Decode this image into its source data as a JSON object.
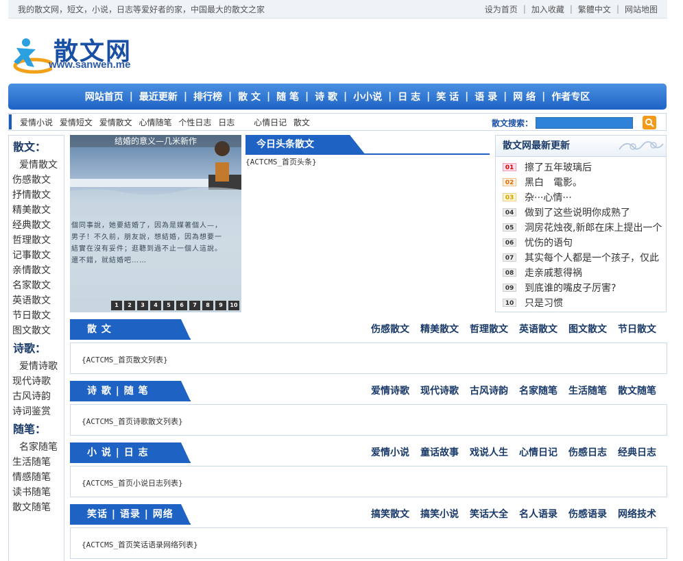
{
  "topbar": {
    "tagline": "我的散文网，短文，小说，日志等爱好者的家，中国最大的散文之家",
    "links": [
      "设为首页",
      "加入收藏",
      "繁體中文",
      "网站地图"
    ]
  },
  "logo": {
    "title": "散文网",
    "domain": "www.sanwen.me"
  },
  "mainnav": [
    "网站首页",
    "最近更新",
    "排行榜",
    "散 文",
    "随 笔",
    "诗 歌",
    "小小说",
    "日 志",
    "笑 话",
    "语 录",
    "网 络",
    "作者专区"
  ],
  "subnav": {
    "links": [
      "爱情小说",
      "爱情短文",
      "爱情散文",
      "心情随笔",
      "个性日志",
      "日志",
      "",
      "心情日记",
      "散文"
    ],
    "search_label": "散文搜索：",
    "search_value": ""
  },
  "sidebar": [
    {
      "heading": "散文：",
      "items": "爱情散文 伤感散文 抒情散文 精美散文 经典散文 哲理散文 记事散文 亲情散文 名家散文 英语散文 节日散文 图文散文"
    },
    {
      "heading": "诗歌：",
      "items": "爱情诗歌 现代诗歌 古风诗韵 诗词鉴赏"
    },
    {
      "heading": "随笔：",
      "items": "名家随笔 生活随笔 情感随笔 读书随笔 散文随笔"
    }
  ],
  "slideshow": {
    "caption": "结婚的意义—几米新作",
    "poem_lines": [
      "個同事說，她要結婚了，因為是媒著個人—，",
      "男子！不久前，朋友說，想結婚，因為想要一",
      "結實在沒有妥件；逛聽到過不止一個人這說。",
      "還不錯，就結婚吧……"
    ],
    "pages": [
      "1",
      "2",
      "3",
      "4",
      "5",
      "6",
      "7",
      "8",
      "9",
      "10"
    ]
  },
  "headline": {
    "title": "今日头条散文",
    "placeholder": "{ACTCMS_首页头条}"
  },
  "latest": {
    "title": "散文网最新更新",
    "items": [
      {
        "n": "01",
        "text": "擦了五年玻璃后"
      },
      {
        "n": "02",
        "text": "黑白　電影。"
      },
      {
        "n": "03",
        "text": "杂···心情···"
      },
      {
        "n": "04",
        "text": "做到了这些说明你成熟了"
      },
      {
        "n": "05",
        "text": "洞房花烛夜,新郎在床上提出一个"
      },
      {
        "n": "06",
        "text": "忧伤的语句"
      },
      {
        "n": "07",
        "text": "其实每个人都是一个孩子，仅此"
      },
      {
        "n": "08",
        "text": "走亲戚惹得祸"
      },
      {
        "n": "09",
        "text": "到底谁的嘴皮子厉害?"
      },
      {
        "n": "10",
        "text": "只是习惯"
      }
    ]
  },
  "sections": [
    {
      "title": "散 文",
      "links": [
        "伤感散文",
        "精美散文",
        "哲理散文",
        "英语散文",
        "图文散文",
        "节日散文"
      ],
      "body": "{ACTCMS_首页散文列表}"
    },
    {
      "title": "诗 歌 | 随 笔",
      "links": [
        "爱情诗歌",
        "现代诗歌",
        "古风诗韵",
        "名家随笔",
        "生活随笔",
        "散文随笔"
      ],
      "body": "{ACTCMS_首页诗歌散文列表}"
    },
    {
      "title": "小 说 | 日 志",
      "links": [
        "爱情小说",
        "童话故事",
        "戏说人生",
        "心情日记",
        "伤感日志",
        "经典日志"
      ],
      "body": "{ACTCMS_首页小说日志列表}"
    },
    {
      "title": "笑话 | 语录 | 网络",
      "links": [
        "搞笑散文",
        "搞笑小说",
        "笑话大全",
        "名人语录",
        "伤感语录",
        "网络技术"
      ],
      "body": "{ACTCMS_首页笑话语录网络列表}"
    }
  ],
  "colors": {
    "brand_blue": "#1e63c4",
    "nav_top": "#4a90e2",
    "search_button": "#f39a1a"
  }
}
